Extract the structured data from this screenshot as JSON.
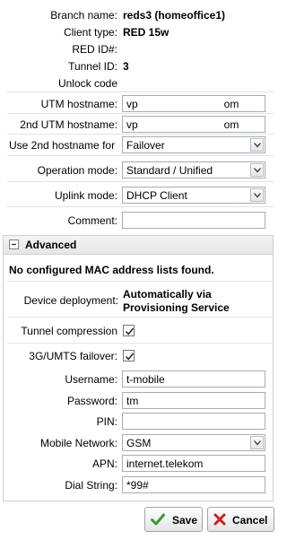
{
  "info": {
    "branch_name": {
      "label": "Branch name:",
      "value": "reds3 (homeoffice1)"
    },
    "client_type": {
      "label": "Client type:",
      "value": "RED 15w"
    },
    "red_id": {
      "label": "RED ID#:",
      "value": ""
    },
    "tunnel_id": {
      "label": "Tunnel ID:",
      "value": "3"
    },
    "unlock_code": {
      "label": "Unlock code",
      "value": ""
    }
  },
  "form": {
    "utm_hostname": {
      "label": "UTM hostname:",
      "value": "vp        om"
    },
    "utm_hostname2": {
      "label": "2nd UTM hostname:",
      "value": "vp        om"
    },
    "use_2nd_hostname_for": {
      "label": "Use 2nd hostname for",
      "value": "Failover"
    },
    "operation_mode": {
      "label": "Operation mode:",
      "value": "Standard / Unified"
    },
    "uplink_mode": {
      "label": "Uplink mode:",
      "value": "DHCP Client"
    },
    "comment": {
      "label": "Comment:",
      "value": ""
    }
  },
  "advanced": {
    "title": "Advanced",
    "toggle_symbol": "−",
    "mac_note": "No configured MAC address lists found.",
    "device_deployment": {
      "label": "Device deployment:",
      "value_line1": "Automatically via",
      "value_line2": "Provisioning Service"
    },
    "tunnel_compression": {
      "label": "Tunnel compression",
      "checked": true
    },
    "umts_failover": {
      "label": "3G/UMTS failover:",
      "checked": true
    },
    "username": {
      "label": "Username:",
      "value": "t-mobile"
    },
    "password": {
      "label": "Password:",
      "value": "tm"
    },
    "pin": {
      "label": "PIN:",
      "value": ""
    },
    "mobile_network": {
      "label": "Mobile Network:",
      "value": "GSM"
    },
    "apn": {
      "label": "APN:",
      "value": "internet.telekom"
    },
    "dial_string": {
      "label": "Dial String:",
      "value": "*99#"
    }
  },
  "buttons": {
    "save": "Save",
    "cancel": "Cancel"
  },
  "colors": {
    "save_check": "#3a9a2a",
    "cancel_x": "#cc2222"
  }
}
